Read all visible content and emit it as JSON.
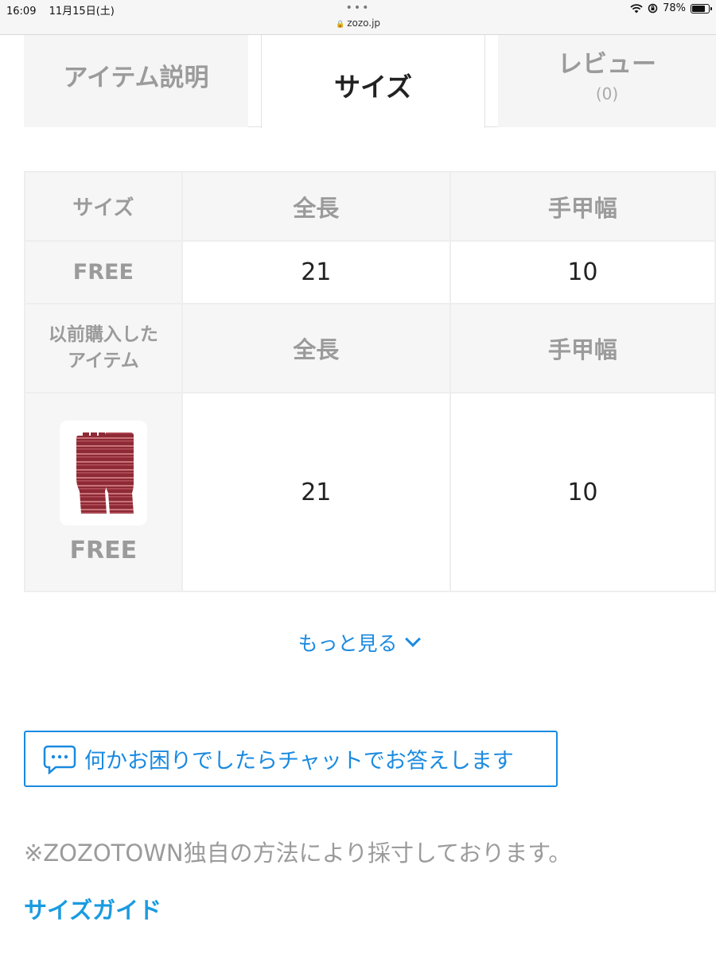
{
  "status_bar": {
    "time": "16:09",
    "date": "11月15日(土)",
    "dots": "•••",
    "url": "zozo.jp",
    "battery": "78%",
    "battery_level": 0.78
  },
  "tabs": [
    {
      "label": "アイテム説明",
      "active": false
    },
    {
      "label": "サイズ",
      "active": true
    },
    {
      "label": "レビュー",
      "count": "(0)",
      "active": false
    }
  ],
  "size_table": {
    "headers": [
      "サイズ",
      "全長",
      "手甲幅"
    ],
    "rows": [
      {
        "size": "FREE",
        "values": [
          "21",
          "10"
        ]
      }
    ],
    "previous_headers": [
      "以前購入した",
      "アイテム",
      "全長",
      "手甲幅"
    ],
    "previous_rows": [
      {
        "size": "FREE",
        "values": [
          "21",
          "10"
        ],
        "image": "knit-fingerless-gloves-image"
      }
    ]
  },
  "more_link": "もっと見る",
  "chat_button": "何かお困りでしたらチャットでお答えします",
  "note": "※ZOZOTOWN独自の方法により採寸しております。",
  "size_guide_link": "サイズガイド",
  "colors": {
    "accent": "#1a8ae0",
    "header_bg": "#f6f6f6",
    "muted_text": "#9b9b9b",
    "glove": "#8e2a35"
  }
}
